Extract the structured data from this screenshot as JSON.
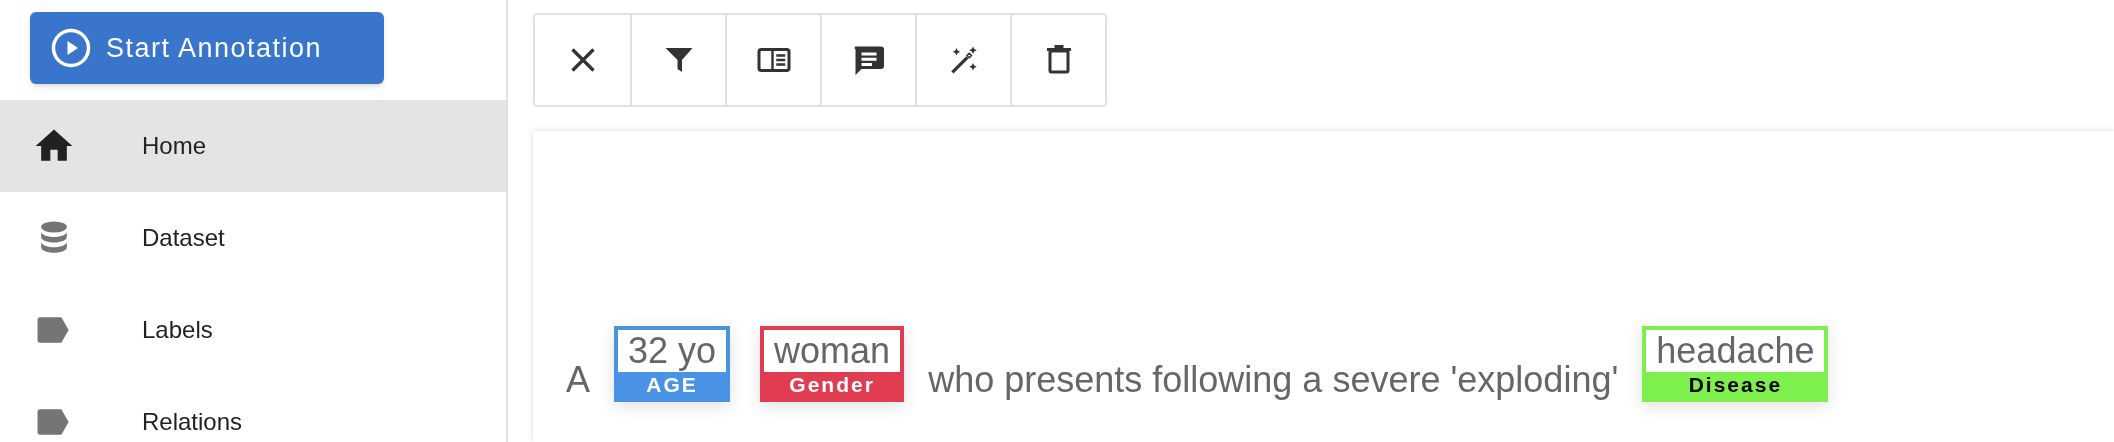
{
  "start_button": {
    "label": "Start Annotation"
  },
  "sidebar": {
    "items": [
      {
        "label": "Home",
        "kind": "home",
        "selected": true
      },
      {
        "label": "Dataset",
        "kind": "database",
        "selected": false
      },
      {
        "label": "Labels",
        "kind": "label",
        "selected": false
      },
      {
        "label": "Relations",
        "kind": "label",
        "selected": false
      }
    ]
  },
  "toolbar": {
    "buttons": [
      {
        "kind": "close"
      },
      {
        "kind": "filter"
      },
      {
        "kind": "book"
      },
      {
        "kind": "comment"
      },
      {
        "kind": "wand"
      },
      {
        "kind": "delete"
      }
    ]
  },
  "document": {
    "segments": [
      {
        "kind": "text",
        "text": "A"
      },
      {
        "kind": "entity",
        "text": "32 yo",
        "label": "AGE",
        "color": "#4a92e6"
      },
      {
        "kind": "entity",
        "text": "woman",
        "label": "Gender",
        "color": "#e03c52"
      },
      {
        "kind": "text",
        "text": "who presents following a severe 'exploding'"
      },
      {
        "kind": "entity",
        "text": "headache",
        "label": "Disease",
        "color": "#7ef04e"
      }
    ]
  }
}
